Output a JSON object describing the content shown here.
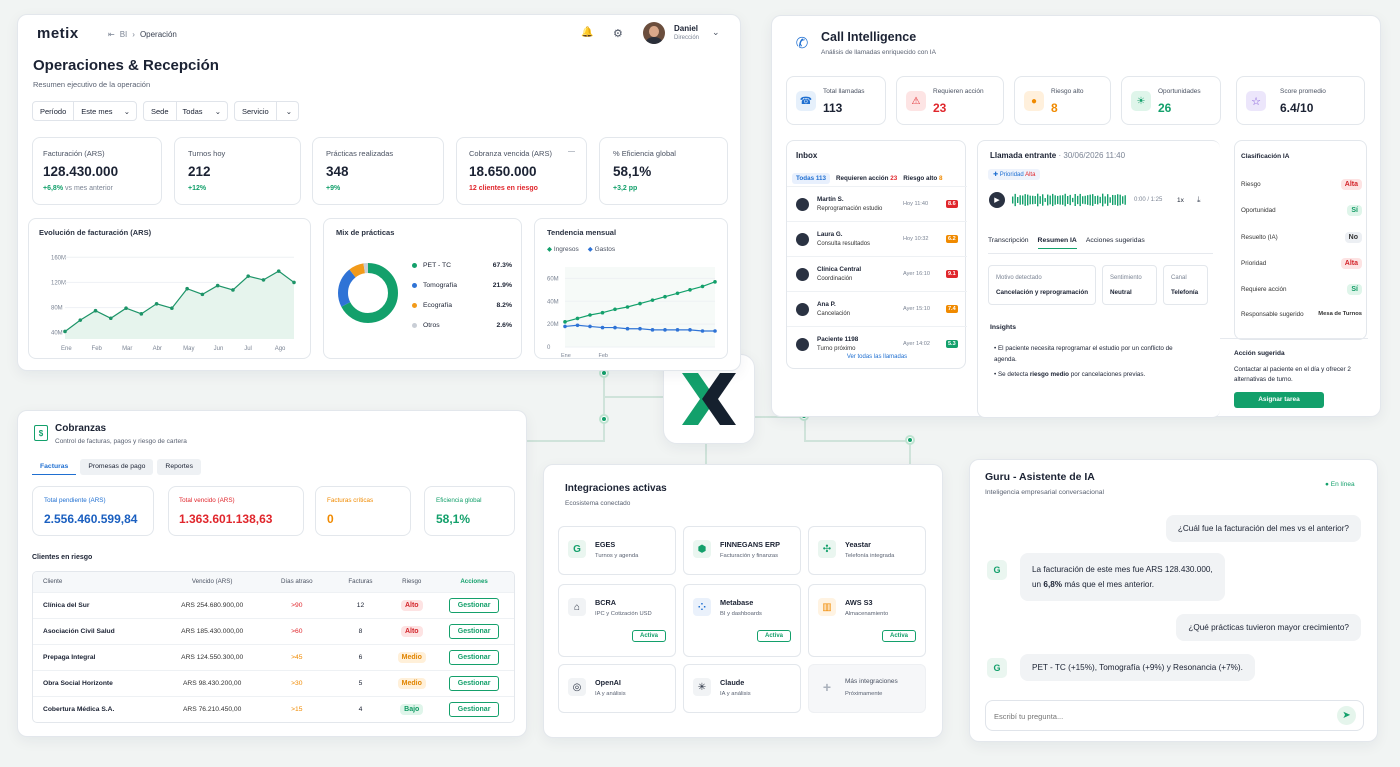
{
  "ops": {
    "logo": "metix",
    "breadcrumb": [
      "BI",
      "Operación"
    ],
    "user_name": "Daniel",
    "user_role": "Dirección",
    "title": "Operaciones & Recepción",
    "subtitle": "Resumen ejecutivo de la operación",
    "filters": {
      "periodo_label": "Período",
      "periodo_value": "Este mes",
      "sede_label": "Sede",
      "sede_value": "Todas",
      "servicio_label": "Servicio"
    },
    "kpis": [
      {
        "label": "Facturación (ARS)",
        "value": "128.430.000",
        "delta": "+6,8%",
        "note": "vs mes anterior"
      },
      {
        "label": "Turnos hoy",
        "value": "212",
        "delta": "+12%",
        "note": ""
      },
      {
        "label": "Prácticas realizadas",
        "value": "348",
        "delta": "+9%",
        "note": ""
      },
      {
        "label": "Cobranza vencida (ARS)",
        "value": "18.650.000",
        "delta": "12 clientes en riesgo",
        "note": ""
      },
      {
        "label": "% Eficiencia global",
        "value": "58,1%",
        "delta": "+3,2 pp",
        "note": ""
      }
    ],
    "kpi_dash": "—",
    "evolucion": {
      "title": "Evolución de facturación (ARS)"
    },
    "mix": {
      "title": "Mix de prácticas",
      "items": [
        {
          "name": "PET - TC",
          "value": "67.3%"
        },
        {
          "name": "Tomografía",
          "value": "21.9%"
        },
        {
          "name": "Ecografía",
          "value": "8.2%"
        },
        {
          "name": "Otros",
          "value": "2.6%"
        }
      ]
    },
    "tendencia": {
      "title": "Tendencia mensual",
      "legend": [
        "Ingresos",
        "Gastos"
      ]
    }
  },
  "chart_data": [
    {
      "type": "area",
      "title": "Evolución de facturación (ARS)",
      "yticks": [
        "160M",
        "120M",
        "80M",
        "40M"
      ],
      "ylim": [
        30,
        170
      ],
      "categories": [
        "Ene",
        "Feb",
        "Mar",
        "Abr",
        "May",
        "Jun",
        "Jul",
        "Ago"
      ],
      "x": [
        0,
        0.5,
        1,
        1.5,
        2,
        2.5,
        3,
        3.5,
        4,
        4.5,
        5,
        5.5,
        6,
        6.5,
        7,
        7.5
      ],
      "values": [
        42,
        60,
        75,
        63,
        79,
        70,
        86,
        79,
        110,
        101,
        115,
        108,
        130,
        124,
        138,
        120
      ]
    },
    {
      "type": "pie",
      "title": "Mix de prácticas",
      "labels": [
        "PET - TC",
        "Tomografía",
        "Ecografía",
        "Otros"
      ],
      "values": [
        67.3,
        21.9,
        8.2,
        2.6
      ]
    },
    {
      "type": "line",
      "title": "Tendencia mensual",
      "yticks": [
        "60M",
        "40M",
        "20M",
        "0"
      ],
      "ylim": [
        0,
        70
      ],
      "xticks": [
        "Ene",
        "Feb"
      ],
      "series": [
        {
          "name": "Ingresos",
          "values": [
            22,
            25,
            28,
            30,
            33,
            35,
            38,
            41,
            44,
            47,
            50,
            53,
            57
          ]
        },
        {
          "name": "Gastos",
          "values": [
            18,
            19,
            18,
            17,
            17,
            16,
            16,
            15,
            15,
            15,
            15,
            14,
            14
          ]
        }
      ]
    }
  ],
  "call": {
    "title": "Call Intelligence",
    "subtitle": "Análisis de llamadas enriquecido con IA",
    "kpis": [
      {
        "label": "Total llamadas",
        "value": "113"
      },
      {
        "label": "Requieren acción",
        "value": "23"
      },
      {
        "label": "Riesgo alto",
        "value": "8"
      },
      {
        "label": "Oportunidades",
        "value": "26"
      },
      {
        "label": "Score promedio",
        "value": "6.4/10"
      }
    ],
    "inbox": {
      "title": "Inbox",
      "tabs": [
        {
          "label": "Todas",
          "count": "113"
        },
        {
          "label": "Requieren acción",
          "count": "23"
        },
        {
          "label": "Riesgo alto",
          "count": "8"
        }
      ],
      "items": [
        {
          "name": "Martín S.",
          "sub": "Reprogramación estudio",
          "time": "Hoy 11:40",
          "score": "8.6"
        },
        {
          "name": "Laura G.",
          "sub": "Consulta resultados",
          "time": "Hoy 10:32",
          "score": "6.2"
        },
        {
          "name": "Clínica Central",
          "sub": "Coordinación",
          "time": "Ayer 16:10",
          "score": "9.1"
        },
        {
          "name": "Ana P.",
          "sub": "Cancelación",
          "time": "Ayer 15:10",
          "score": "7.4"
        },
        {
          "name": "Paciente 1198",
          "sub": "Turno próximo",
          "time": "Ayer 14:02",
          "score": "5.3"
        }
      ],
      "footer": "Ver todas las llamadas"
    },
    "detail": {
      "title": "Llamada entrante",
      "date": "30/06/2026 11:40",
      "priority_label": "Prioridad",
      "priority_value": "Alta",
      "time": "0:00 / 1:25",
      "speed": "1x",
      "tabs": [
        "Transcripción",
        "Resumen IA",
        "Acciones sugeridas"
      ],
      "fields": [
        {
          "label": "Motivo detectado",
          "value": "Cancelación y reprogramación"
        },
        {
          "label": "Sentimiento",
          "value": "Neutral"
        },
        {
          "label": "Canal",
          "value": "Telefonía"
        }
      ],
      "insights_title": "Insights",
      "insight1": "El paciente necesita reprogramar el estudio por un conflicto de agenda.",
      "insight2_pre": "Se detecta ",
      "insight2_bold": "riesgo medio",
      "insight2_post": " por cancelaciones previas."
    },
    "classif": {
      "title": "Clasificación IA",
      "rows": [
        {
          "label": "Riesgo",
          "value": "Alta"
        },
        {
          "label": "Oportunidad",
          "value": "Sí"
        },
        {
          "label": "Resuelto (IA)",
          "value": "No"
        },
        {
          "label": "Prioridad",
          "value": "Alta"
        },
        {
          "label": "Requiere acción",
          "value": "Sí"
        },
        {
          "label": "Responsable sugerido",
          "value": "Mesa de Turnos"
        }
      ],
      "action_title": "Acción sugerida",
      "action_text": "Contactar al paciente en el día y ofrecer 2 alternativas de turno.",
      "action_button": "Asignar tarea"
    }
  },
  "cobranzas": {
    "title": "Cobranzas",
    "subtitle": "Control de facturas, pagos y riesgo de cartera",
    "tabs": [
      "Facturas",
      "Promesas de pago",
      "Reportes"
    ],
    "kpis": [
      {
        "label": "Total pendiente (ARS)",
        "value": "2.556.460.599,84"
      },
      {
        "label": "Total vencido (ARS)",
        "value": "1.363.601.138,63"
      },
      {
        "label": "Facturas críticas",
        "value": "0"
      },
      {
        "label": "Eficiencia global",
        "value": "58,1%"
      }
    ],
    "section_title": "Clientes en riesgo",
    "columns": [
      "Cliente",
      "Vencido (ARS)",
      "Días atraso",
      "Facturas",
      "Riesgo",
      "Acciones"
    ],
    "rows": [
      {
        "cliente": "Clínica del Sur",
        "vencido": "ARS 254.680.900,00",
        "dias": ">90",
        "facturas": "12",
        "riesgo": "Alto",
        "accion": "Gestionar"
      },
      {
        "cliente": "Asociación Civil Salud",
        "vencido": "ARS 185.430.000,00",
        "dias": ">60",
        "facturas": "8",
        "riesgo": "Alto",
        "accion": "Gestionar"
      },
      {
        "cliente": "Prepaga Integral",
        "vencido": "ARS 124.550.300,00",
        "dias": ">45",
        "facturas": "6",
        "riesgo": "Medio",
        "accion": "Gestionar"
      },
      {
        "cliente": "Obra Social Horizonte",
        "vencido": "ARS 98.430.200,00",
        "dias": ">30",
        "facturas": "5",
        "riesgo": "Medio",
        "accion": "Gestionar"
      },
      {
        "cliente": "Cobertura Médica S.A.",
        "vencido": "ARS 76.210.450,00",
        "dias": ">15",
        "facturas": "4",
        "riesgo": "Bajo",
        "accion": "Gestionar"
      }
    ]
  },
  "integraciones": {
    "title": "Integraciones activas",
    "subtitle": "Ecosistema conectado",
    "items": [
      {
        "name": "EGES",
        "sub": "Turnos y agenda",
        "badge": ""
      },
      {
        "name": "FINNEGANS ERP",
        "sub": "Facturación y finanzas",
        "badge": ""
      },
      {
        "name": "Yeastar",
        "sub": "Telefonía integrada",
        "badge": ""
      },
      {
        "name": "BCRA",
        "sub": "IPC y Cotización USD",
        "badge": "Activa"
      },
      {
        "name": "Metabase",
        "sub": "BI y dashboards",
        "badge": "Activa"
      },
      {
        "name": "AWS S3",
        "sub": "Almacenamiento",
        "badge": "Activa"
      },
      {
        "name": "OpenAI",
        "sub": "IA y análisis",
        "badge": ""
      },
      {
        "name": "Claude",
        "sub": "IA y análisis",
        "badge": ""
      },
      {
        "name": "Más integraciones",
        "sub": "Próximamente",
        "badge": ""
      }
    ]
  },
  "guru": {
    "title": "Guru - Asistente de IA",
    "subtitle": "Inteligencia empresarial conversacional",
    "status": "En línea",
    "q1": "¿Cuál fue la facturación del mes vs el anterior?",
    "a1_line1": "La facturación de este mes fue ARS 128.430.000,",
    "a1_pre": "un ",
    "a1_bold": "6,8%",
    "a1_post": " más que el mes anterior.",
    "q2": "¿Qué prácticas tuvieron mayor crecimiento?",
    "a2": "PET - TC (+15%), Tomografía (+9%) y Resonancia (+7%).",
    "placeholder": "Escribí tu pregunta..."
  },
  "colors": {
    "accent": "#13a06b",
    "danger": "#e0262c",
    "warning": "#f08a00",
    "blue": "#1f6fd1",
    "donut": [
      "#13a06b",
      "#2f73d6",
      "#f29a1a",
      "#c9ced6"
    ]
  }
}
